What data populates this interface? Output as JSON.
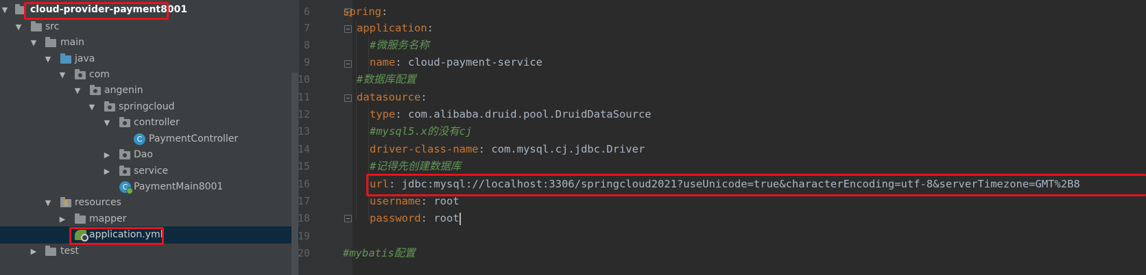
{
  "project_tree": {
    "items": [
      {
        "label": "cloud-provider-payment8001",
        "kind": "module",
        "expanded": true
      },
      {
        "label": "src",
        "kind": "folder",
        "expanded": true
      },
      {
        "label": "main",
        "kind": "folder",
        "expanded": true
      },
      {
        "label": "java",
        "kind": "source-root",
        "expanded": true
      },
      {
        "label": "com",
        "kind": "package",
        "expanded": true
      },
      {
        "label": "angenin",
        "kind": "package",
        "expanded": true
      },
      {
        "label": "springcloud",
        "kind": "package",
        "expanded": true
      },
      {
        "label": "controller",
        "kind": "package",
        "expanded": true
      },
      {
        "label": "PaymentController",
        "kind": "class",
        "icon_text": "C"
      },
      {
        "label": "Dao",
        "kind": "package",
        "expanded": false
      },
      {
        "label": "service",
        "kind": "package",
        "expanded": false
      },
      {
        "label": "PaymentMain8001",
        "kind": "main-class",
        "icon_text": "C"
      },
      {
        "label": "resources",
        "kind": "resources-root",
        "expanded": true
      },
      {
        "label": "mapper",
        "kind": "folder",
        "expanded": false
      },
      {
        "label": "application.yml",
        "kind": "yaml-file",
        "selected": true
      },
      {
        "label": "test",
        "kind": "folder",
        "expanded": false
      }
    ]
  },
  "editor": {
    "line_numbers": [
      "6",
      "7",
      "8",
      "9",
      "10",
      "11",
      "12",
      "13",
      "14",
      "15",
      "16",
      "17",
      "18",
      "19",
      "20"
    ],
    "lines": {
      "l6": {
        "key": "spring",
        "sep": ":"
      },
      "l7": {
        "key": "application",
        "sep": ":"
      },
      "l8": {
        "comment": "#微服务名称"
      },
      "l9": {
        "key": "name",
        "sep": ": ",
        "value": "cloud-payment-service"
      },
      "l10": {
        "comment": "#数据库配置"
      },
      "l11": {
        "key": "datasource",
        "sep": ":"
      },
      "l12": {
        "key": "type",
        "sep": ": ",
        "value": "com.alibaba.druid.pool.DruidDataSource"
      },
      "l13": {
        "comment": "#mysql5.x的没有cj"
      },
      "l14": {
        "key": "driver-class-name",
        "sep": ": ",
        "value": "com.mysql.cj.jdbc.Driver"
      },
      "l15": {
        "comment": "#记得先创建数据库"
      },
      "l16": {
        "key": "url",
        "sep": ": ",
        "value": "jdbc:mysql://localhost:3306/springcloud2021?useUnicode=true&characterEncoding=utf-8&serverTimezone=GMT%2B8"
      },
      "l17": {
        "key": "username",
        "sep": ": ",
        "value": "root"
      },
      "l18": {
        "key": "password",
        "sep": ": ",
        "value": "root"
      },
      "l20": {
        "comment": "#mybatis配置"
      }
    }
  },
  "colors": {
    "tree_bg": "#3c3f41",
    "editor_bg": "#2b2b2b",
    "gutter_bg": "#313335",
    "yaml_key": "#cc7832",
    "comment": "#629755",
    "text": "#a9b7c6",
    "highlight_box": "#e8131b",
    "selection": "#0d293e"
  }
}
